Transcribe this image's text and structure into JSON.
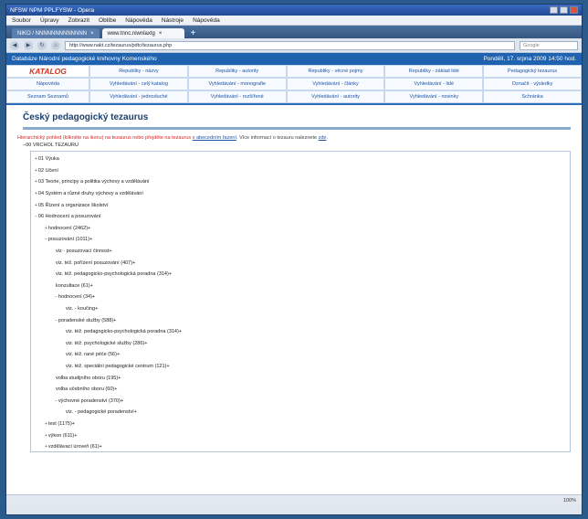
{
  "window": {
    "title": "NFSW NPM PPLFYSW - Opera"
  },
  "menubar": [
    "Soubor",
    "Úpravy",
    "Zobrazit",
    "Oblíbe",
    "Nápověda",
    "Nástroje",
    "Nápověda"
  ],
  "tabs": [
    {
      "label": "NIKO / NNNNNNNNNNNNN"
    },
    {
      "label": "www.tnnc.niwnlaxtg"
    }
  ],
  "navbar": {
    "url": "http://www.nakt.cz/tezaurus/pdtc/tezaurus.php",
    "search_placeholder": "Google"
  },
  "site": {
    "header_left": "Databáze Národní pedagogické knihovny Komenského",
    "header_right": "Pondělí, 17. srpna 2009 14:50 hod.",
    "logo": "KATALOG",
    "nav_rows": [
      [
        "Republiky - názvy",
        "Republiky - autority",
        "Republiky - věcné pojmy",
        "Republiky - základ lidé",
        "Pedagogický tezaurus"
      ],
      [
        "Vyhledávání - celý katalog",
        "Vyhledávání - monografie",
        "Vyhledávání - články",
        "Vyhledávání - lidé",
        "Označit - výsledky"
      ],
      [
        "Vyhledávání - jednoduché",
        "Vyhledávání - rozšířené",
        "Vyhledávání - autority",
        "Vyhledávání - novinky",
        "Schránka"
      ]
    ],
    "nav_left": [
      "Nápověda",
      "Seznam Seznamů"
    ]
  },
  "page": {
    "title": "Český pedagogický tezaurus",
    "notice_red": "Hierarchický pohled (klikněte na ikonu) na tezaurus nebo přejděte na tezaurus",
    "notice_link": "v abecedním řazení",
    "notice_rest": "Více informací o tezauru naleznete",
    "notice_link2": "zde",
    "tree_header": "00 VRCHOL TEZAURU"
  },
  "tree": [
    {
      "level": 0,
      "toggle": "+",
      "label": "01 Výuka"
    },
    {
      "level": 0,
      "toggle": "+",
      "label": "02 Učení"
    },
    {
      "level": 0,
      "toggle": "+",
      "label": "03 Teorie, principy a politika výchovy a vzdělávání"
    },
    {
      "level": 0,
      "toggle": "+",
      "label": "04 Systém a různé druhy výchovy a vzdělávání"
    },
    {
      "level": 0,
      "toggle": "+",
      "label": "05 Řízení a organizace školství"
    },
    {
      "level": 0,
      "toggle": "−",
      "label": "06 Hodnocení a posuzování"
    },
    {
      "level": 1,
      "toggle": "+",
      "label": "hodnocení (2462)+"
    },
    {
      "level": 1,
      "toggle": "−",
      "label": "posuzování (1011)+"
    },
    {
      "level": 2,
      "toggle": "",
      "label": "viz - posuzovací činnost+"
    },
    {
      "level": 2,
      "toggle": "",
      "label": "viz. též. pořízení posuzování (407)+"
    },
    {
      "level": 2,
      "toggle": "",
      "label": "viz. též. pedagogicko-psychologická poradna (314)+"
    },
    {
      "level": 2,
      "toggle": "",
      "label": "konzultace (61)+"
    },
    {
      "level": 2,
      "toggle": "−",
      "label": "hodnocení (34)+"
    },
    {
      "level": 3,
      "toggle": "",
      "label": "viz. - koučing+"
    },
    {
      "level": 2,
      "toggle": "−",
      "label": "poradenské služby (588)+"
    },
    {
      "level": 3,
      "toggle": "",
      "label": "viz. též. pedagogicko-psychologická poradna (314)+"
    },
    {
      "level": 3,
      "toggle": "",
      "label": "viz. též. psychologické služby (286)+"
    },
    {
      "level": 3,
      "toggle": "",
      "label": "viz. též. rané péče (56)+"
    },
    {
      "level": 3,
      "toggle": "",
      "label": "viz. též. speciální pedagogické centrum (121)+"
    },
    {
      "level": 2,
      "toggle": "",
      "label": "volba studijního oboru (195)+"
    },
    {
      "level": 2,
      "toggle": "",
      "label": "volba učebního oboru (60)+"
    },
    {
      "level": 2,
      "toggle": "−",
      "label": "výchovné poradenství (370)+"
    },
    {
      "level": 3,
      "toggle": "",
      "label": "viz. - pedagogické poradenství+"
    },
    {
      "level": 1,
      "toggle": "+",
      "label": "test (1175)+"
    },
    {
      "level": 1,
      "toggle": "+",
      "label": "výkon (611)+"
    },
    {
      "level": 1,
      "toggle": "+",
      "label": "vzdělávací úroveň (61)+"
    },
    {
      "level": 1,
      "toggle": "+",
      "label": "zkušební systém (461)+"
    }
  ],
  "status": {
    "zoom": "100%"
  }
}
